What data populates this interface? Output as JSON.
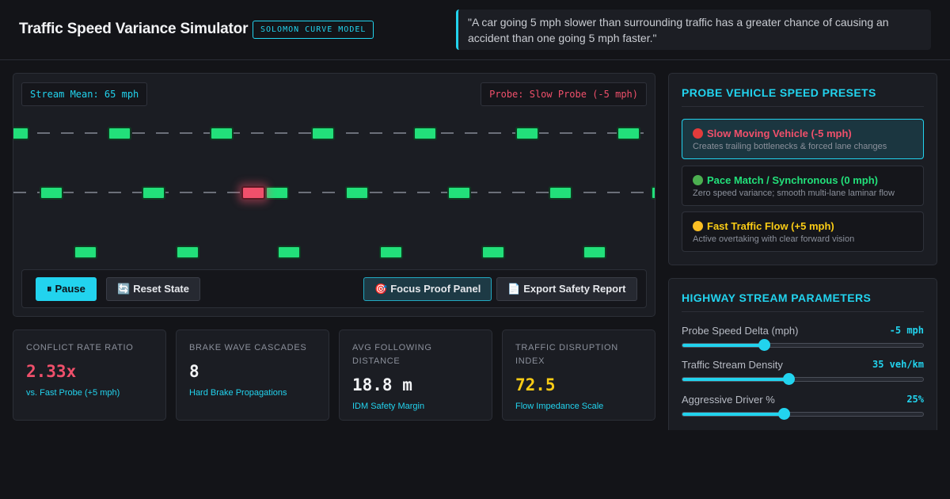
{
  "header": {
    "title": "Traffic Speed Variance Simulator",
    "badge": "SOLOMON CURVE MODEL",
    "quote": "\"A car going 5 mph slower than surrounding traffic has a greater chance of causing an accident than one going 5 mph faster.\""
  },
  "simulation": {
    "stream_mean_label": "Stream Mean: 65 mph",
    "probe_label": "Probe: Slow Probe (-5 mph)"
  },
  "controls": {
    "pause_icon": "pause-icon",
    "pause_label": "Pause",
    "reset_icon": "refresh-icon",
    "reset_label": "Reset State",
    "focus_icon": "target-icon",
    "focus_label": "Focus Proof Panel",
    "export_icon": "document-icon",
    "export_label": "Export Safety Report"
  },
  "stats": [
    {
      "label": "CONFLICT RATE RATIO",
      "value": "2.33x",
      "sub": "vs. Fast Probe (+5 mph)",
      "color": "#f0506b"
    },
    {
      "label": "BRAKE WAVE CASCADES",
      "value": "8",
      "sub": "Hard Brake Propagations",
      "color": "#f2f3f5"
    },
    {
      "label": "AVG FOLLOWING DISTANCE",
      "value": "18.8 m",
      "sub": "IDM Safety Margin",
      "color": "#f2f3f5"
    },
    {
      "label": "TRAFFIC DISRUPTION INDEX",
      "value": "72.5",
      "sub": "Flow Impedance Scale",
      "color": "#facc15"
    }
  ],
  "presets": {
    "title": "PROBE VEHICLE SPEED PRESETS",
    "items": [
      {
        "title": "Slow Moving Vehicle (-5 mph)",
        "desc": "Creates trailing bottlenecks & forced lane changes",
        "color": "#f0506b",
        "dot": "#e23b3b",
        "active": true
      },
      {
        "title": "Pace Match / Synchronous (0 mph)",
        "desc": "Zero speed variance; smooth multi-lane laminar flow",
        "color": "#22e07a",
        "dot": "#4caf50",
        "active": false
      },
      {
        "title": "Fast Traffic Flow (+5 mph)",
        "desc": "Active overtaking with clear forward vision",
        "color": "#facc15",
        "dot": "#fbbf24",
        "active": false
      }
    ]
  },
  "parameters": {
    "title": "HIGHWAY STREAM PARAMETERS",
    "items": [
      {
        "label": "Probe Speed Delta (mph)",
        "value": "-5 mph",
        "level": 0.34
      },
      {
        "label": "Traffic Stream Density",
        "value": "35 veh/km",
        "level": 0.44
      },
      {
        "label": "Aggressive Driver %",
        "value": "25%",
        "level": 0.42
      }
    ]
  },
  "colors": {
    "accent": "#22d3ee",
    "car": "#22e07a",
    "probe_car": "#f0506b",
    "background": "#131418"
  }
}
